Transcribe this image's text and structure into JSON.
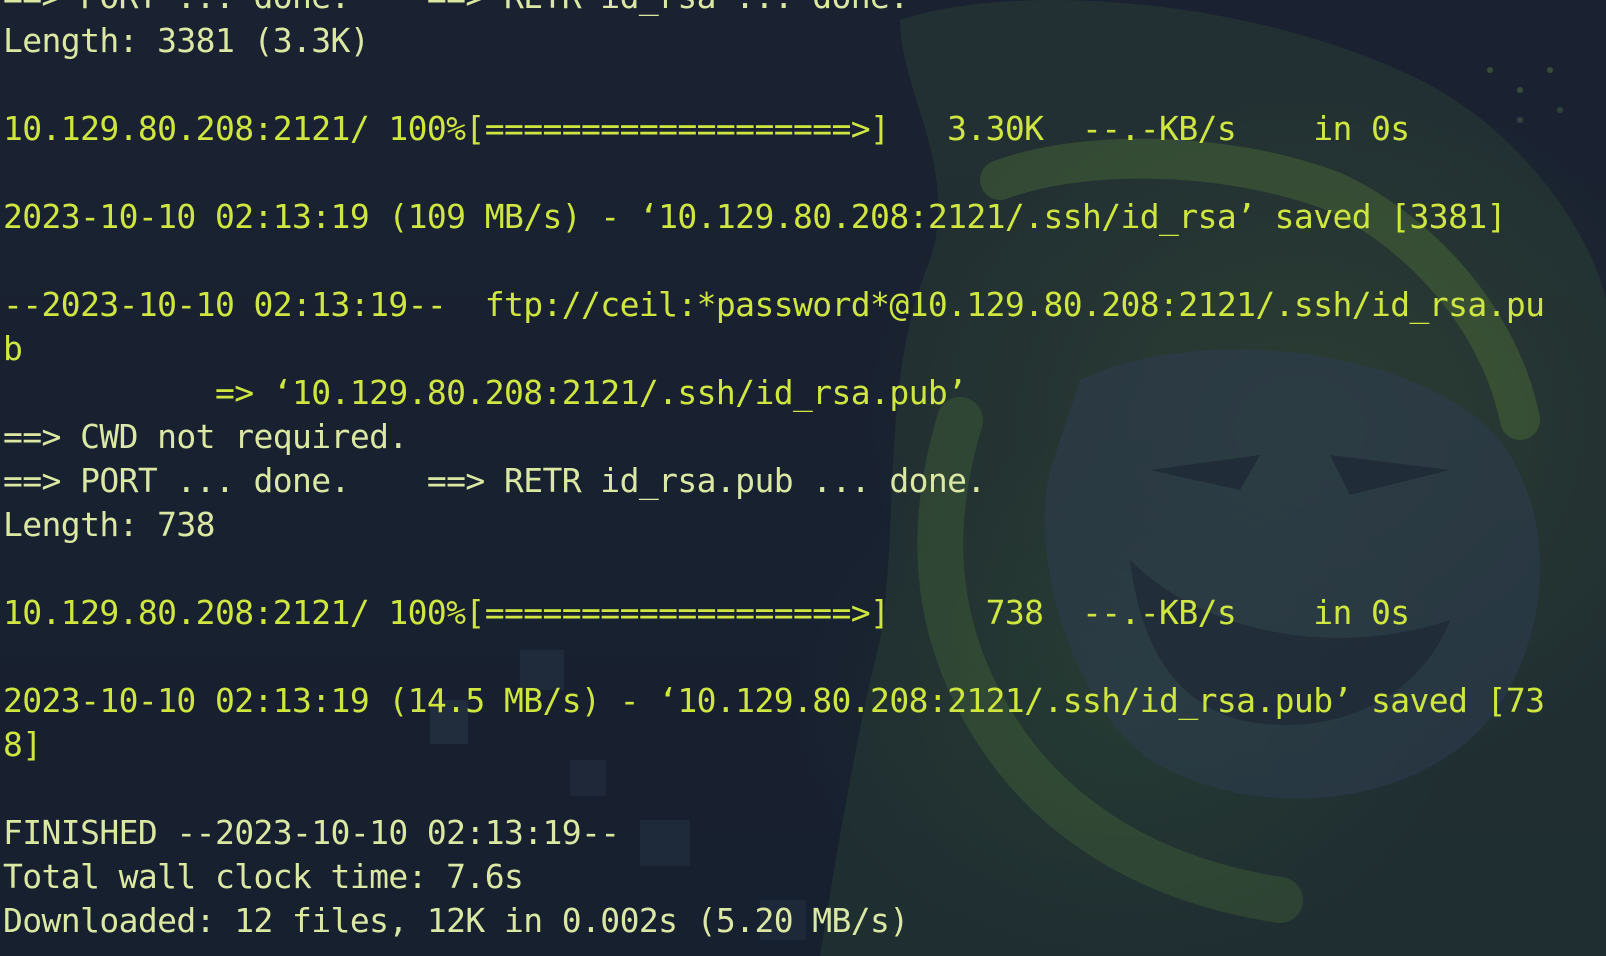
{
  "terminal": {
    "theme": {
      "background": "#17202f",
      "text_yellow": "#cfe640",
      "text_light": "#dbe8a4",
      "wallpaper_accent": "#2f5a3a"
    },
    "lines": [
      {
        "text": "==> PORT ... done.    ==> RETR id_rsa ... done.",
        "tone": "light"
      },
      {
        "text": "Length: 3381 (3.3K)",
        "tone": "light"
      },
      {
        "text": "",
        "tone": "light"
      },
      {
        "text": "10.129.80.208:2121/ 100%[===================>]   3.30K  --.-KB/s    in 0s",
        "tone": "yellow"
      },
      {
        "text": "",
        "tone": "light"
      },
      {
        "text": "2023-10-10 02:13:19 (109 MB/s) - ‘10.129.80.208:2121/.ssh/id_rsa’ saved [3381]",
        "tone": "yellow"
      },
      {
        "text": "",
        "tone": "light"
      },
      {
        "text": "--2023-10-10 02:13:19--  ftp://ceil:*password*@10.129.80.208:2121/.ssh/id_rsa.pu",
        "tone": "yellow"
      },
      {
        "text": "b",
        "tone": "yellow"
      },
      {
        "text": "           => ‘10.129.80.208:2121/.ssh/id_rsa.pub’",
        "tone": "yellow"
      },
      {
        "text": "==> CWD not required.",
        "tone": "light"
      },
      {
        "text": "==> PORT ... done.    ==> RETR id_rsa.pub ... done.",
        "tone": "light"
      },
      {
        "text": "Length: 738",
        "tone": "light"
      },
      {
        "text": "",
        "tone": "light"
      },
      {
        "text": "10.129.80.208:2121/ 100%[===================>]     738  --.-KB/s    in 0s",
        "tone": "yellow"
      },
      {
        "text": "",
        "tone": "light"
      },
      {
        "text": "2023-10-10 02:13:19 (14.5 MB/s) - ‘10.129.80.208:2121/.ssh/id_rsa.pub’ saved [73",
        "tone": "yellow"
      },
      {
        "text": "8]",
        "tone": "yellow"
      },
      {
        "text": "",
        "tone": "light"
      },
      {
        "text": "FINISHED --2023-10-10 02:13:19--",
        "tone": "light"
      },
      {
        "text": "Total wall clock time: 7.6s",
        "tone": "light"
      },
      {
        "text": "Downloaded: 12 files, 12K in 0.002s (5.20 MB/s)",
        "tone": "light"
      }
    ]
  }
}
